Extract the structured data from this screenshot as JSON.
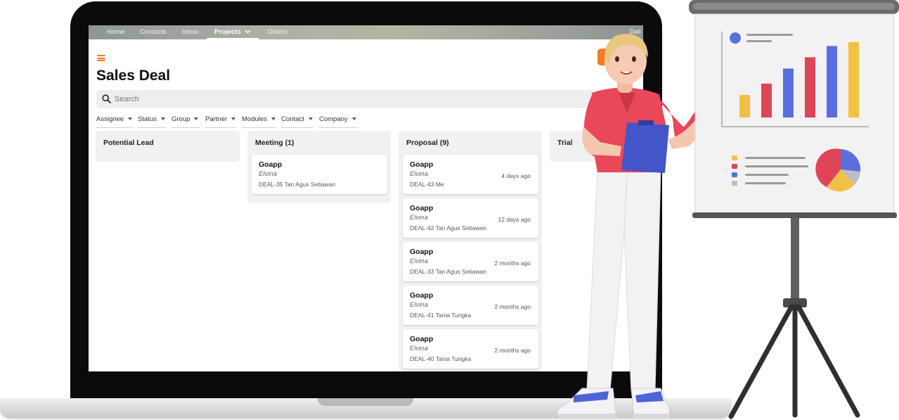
{
  "nav": {
    "items": [
      {
        "label": "Home"
      },
      {
        "label": "Contacts"
      },
      {
        "label": "Inbox"
      },
      {
        "label": "Projects"
      },
      {
        "label": "Orders"
      }
    ],
    "user_partial": "Dali"
  },
  "page": {
    "title": "Sales Deal"
  },
  "search": {
    "placeholder": "Search"
  },
  "filters": [
    {
      "label": "Assignee"
    },
    {
      "label": "Status"
    },
    {
      "label": "Group"
    },
    {
      "label": "Partner"
    },
    {
      "label": "Modules"
    },
    {
      "label": "Contact"
    },
    {
      "label": "Company"
    }
  ],
  "columns": [
    {
      "title": "Potential Lead",
      "cards": []
    },
    {
      "title": "Meeting (1)",
      "cards": [
        {
          "company": "Goapp",
          "contact": "Elvina",
          "deal": "DEAL-35 Tan Agus Setiawan",
          "time": ""
        }
      ]
    },
    {
      "title": "Proposal (9)",
      "cards": [
        {
          "company": "Goapp",
          "contact": "Elvina",
          "deal": "DEAL-43 Me",
          "time": "4 days ago"
        },
        {
          "company": "Goapp",
          "contact": "Elvina",
          "deal": "DEAL-42 Tan Agus Setiawan",
          "time": "12 days ago"
        },
        {
          "company": "Goapp",
          "contact": "Elvina",
          "deal": "DEAL-33 Tan Agus Setiawan",
          "time": "2 months ago"
        },
        {
          "company": "Goapp",
          "contact": "Elvina",
          "deal": "DEAL-41 Tania Tungka",
          "time": "2 months ago"
        },
        {
          "company": "Goapp",
          "contact": "Elvina",
          "deal": "DEAL-40 Tania Tungka",
          "time": "2 months ago"
        }
      ]
    },
    {
      "title": "Trial",
      "cards": []
    }
  ],
  "colors": {
    "accent": "#f47c24",
    "bar_yellow": "#f2c046",
    "bar_red": "#e04457",
    "bar_blue": "#5b6fdc",
    "shirt": "#e8485a",
    "clipboard": "#4256c9"
  },
  "illustration": {
    "board_bar_levels": [
      0.3,
      0.45,
      0.65,
      0.8,
      0.95,
      1.0
    ]
  }
}
